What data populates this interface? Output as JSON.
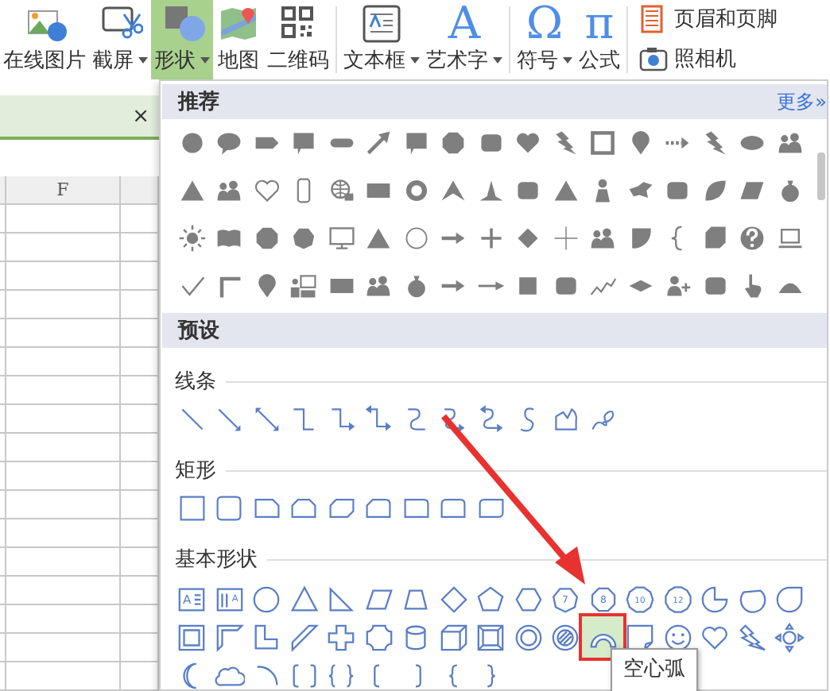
{
  "ribbon": [
    {
      "label": "在线图片",
      "kind": "online-picture",
      "dropdown": false,
      "selected": false
    },
    {
      "label": "截屏",
      "kind": "screenshot",
      "dropdown": true,
      "selected": false
    },
    {
      "label": "形状",
      "kind": "shapes",
      "dropdown": true,
      "selected": true
    },
    {
      "label": "地图",
      "kind": "map",
      "dropdown": false,
      "selected": false
    },
    {
      "label": "二维码",
      "kind": "qr",
      "dropdown": false,
      "selected": false
    },
    {
      "label": "文本框",
      "kind": "textbox",
      "dropdown": true,
      "selected": false
    },
    {
      "label": "艺术字",
      "kind": "glyph",
      "glyph": "A",
      "dropdown": true,
      "selected": false
    },
    {
      "label": "符号",
      "kind": "glyph",
      "glyph": "Ω",
      "dropdown": true,
      "selected": false
    },
    {
      "label": "公式",
      "kind": "glyph",
      "glyph": "π",
      "dropdown": false,
      "selected": false
    }
  ],
  "ribbon_side": [
    {
      "label": "页眉和页脚",
      "kind": "header-footer"
    },
    {
      "label": "照相机",
      "kind": "camera"
    }
  ],
  "sheet": {
    "tab_close": "×",
    "column_header": "F"
  },
  "panel": {
    "recommended_title": "推荐",
    "more_link": "更多»",
    "presets_title": "预设",
    "lines_title": "线条",
    "rectangles_title": "矩形",
    "basic": {
      "title": "基本形状",
      "shapes": [
        {
          "kind": "textbox",
          "label": "A",
          "selected": false
        },
        {
          "kind": "vertical-textbox",
          "label": "A",
          "selected": false
        },
        {
          "kind": "oval",
          "selected": false
        },
        {
          "kind": "triangle",
          "selected": false
        },
        {
          "kind": "right-triangle",
          "selected": false
        },
        {
          "kind": "parallelogram",
          "selected": false
        },
        {
          "kind": "trapezoid",
          "selected": false
        },
        {
          "kind": "diamond",
          "selected": false
        },
        {
          "kind": "pentagon",
          "selected": false
        },
        {
          "kind": "hexagon",
          "selected": false
        },
        {
          "kind": "heptagon",
          "label": "7",
          "selected": false
        },
        {
          "kind": "octagon",
          "label": "8",
          "selected": false
        },
        {
          "kind": "decagon",
          "label": "10",
          "selected": false
        },
        {
          "kind": "dodecagon",
          "label": "12",
          "selected": false
        },
        {
          "kind": "pie",
          "selected": false
        },
        {
          "kind": "chord",
          "selected": false
        },
        {
          "kind": "teardrop",
          "selected": false
        },
        {
          "kind": "frame",
          "selected": false
        },
        {
          "kind": "half-frame",
          "selected": false
        },
        {
          "kind": "l-shape",
          "selected": false
        },
        {
          "kind": "diagonal-stripe",
          "selected": false
        },
        {
          "kind": "cross",
          "selected": false
        },
        {
          "kind": "plaque",
          "selected": false
        },
        {
          "kind": "can",
          "selected": false
        },
        {
          "kind": "cube",
          "selected": false
        },
        {
          "kind": "bevel",
          "selected": false
        },
        {
          "kind": "donut",
          "selected": false
        },
        {
          "kind": "no-symbol",
          "selected": false
        },
        {
          "kind": "block-arc",
          "selected": true
        },
        {
          "kind": "folded-corner",
          "selected": false
        },
        {
          "kind": "smiley",
          "selected": false
        },
        {
          "kind": "heart",
          "selected": false
        },
        {
          "kind": "lightning",
          "selected": false
        },
        {
          "kind": "sun",
          "selected": false
        },
        {
          "kind": "moon",
          "selected": false
        },
        {
          "kind": "cloud",
          "selected": false
        },
        {
          "kind": "arc",
          "selected": false
        },
        {
          "kind": "bracket-pair",
          "selected": false
        },
        {
          "kind": "brace-pair",
          "selected": false
        },
        {
          "kind": "left-bracket",
          "selected": false
        },
        {
          "kind": "right-bracket",
          "selected": false
        },
        {
          "kind": "left-brace",
          "selected": false
        },
        {
          "kind": "right-brace",
          "selected": false
        }
      ]
    },
    "tooltip": "空心弧"
  }
}
